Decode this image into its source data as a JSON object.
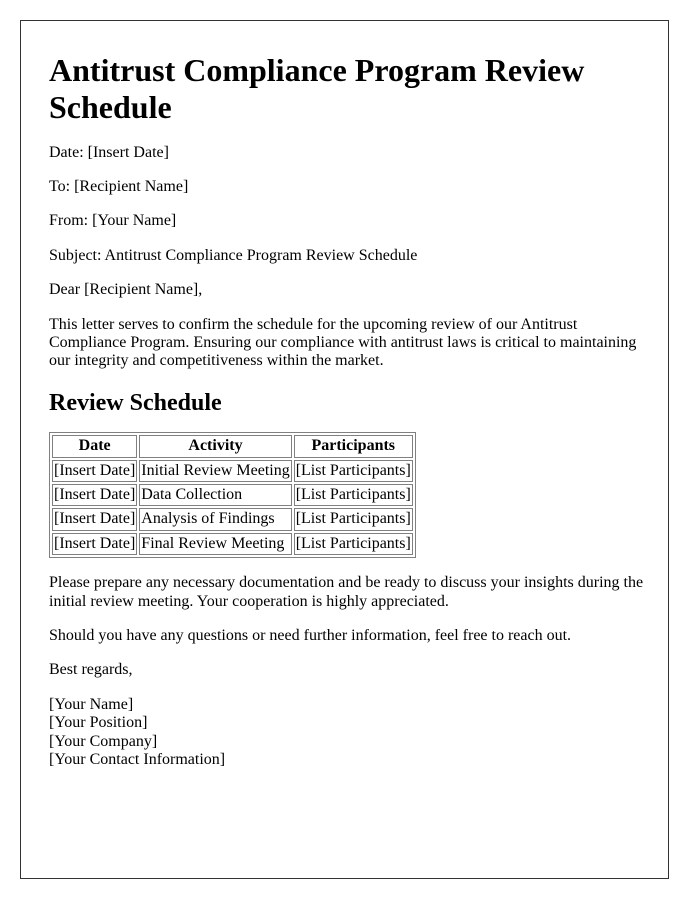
{
  "document": {
    "title": "Antitrust Compliance Program Review Schedule",
    "meta": {
      "date": "Date: [Insert Date]",
      "to": "To: [Recipient Name]",
      "from": "From: [Your Name]",
      "subject": "Subject: Antitrust Compliance Program Review Schedule"
    },
    "salutation": "Dear [Recipient Name],",
    "intro_paragraph": "This letter serves to confirm the schedule for the upcoming review of our Antitrust Compliance Program. Ensuring our compliance with antitrust laws is critical to maintaining our integrity and competitiveness within the market.",
    "schedule_heading": "Review Schedule",
    "schedule_table": {
      "headers": [
        "Date",
        "Activity",
        "Participants"
      ],
      "rows": [
        [
          "[Insert Date]",
          "Initial Review Meeting",
          "[List Participants]"
        ],
        [
          "[Insert Date]",
          "Data Collection",
          "[List Participants]"
        ],
        [
          "[Insert Date]",
          "Analysis of Findings",
          "[List Participants]"
        ],
        [
          "[Insert Date]",
          "Final Review Meeting",
          "[List Participants]"
        ]
      ]
    },
    "prepare_paragraph": "Please prepare any necessary documentation and be ready to discuss your insights during the initial review meeting. Your cooperation is highly appreciated.",
    "questions_paragraph": "Should you have any questions or need further information, feel free to reach out.",
    "closing": "Best regards,",
    "signature": {
      "name": "[Your Name]",
      "position": "[Your Position]",
      "company": "[Your Company]",
      "contact": "[Your Contact Information]"
    }
  }
}
